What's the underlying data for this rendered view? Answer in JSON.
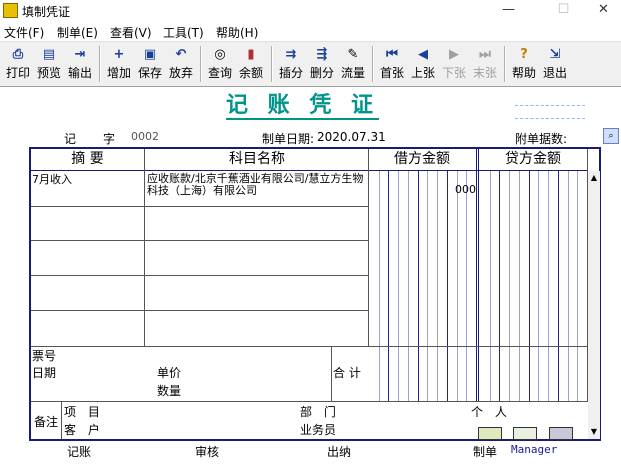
{
  "window": {
    "title": "填制凭证",
    "minimize": "—",
    "maximize": "☐",
    "close": "✕"
  },
  "menu": [
    "文件(F)",
    "制单(E)",
    "查看(V)",
    "工具(T)",
    "帮助(H)"
  ],
  "toolbar": {
    "print": "打印",
    "preview": "预览",
    "export": "输出",
    "add": "增加",
    "save": "保存",
    "discard": "放弃",
    "query": "查询",
    "balance": "余额",
    "insert": "插分",
    "delete": "删分",
    "flow": "流量",
    "first": "首张",
    "prev": "上张",
    "next": "下张",
    "last": "末张",
    "help": "帮助",
    "exit": "退出"
  },
  "voucher": {
    "title": "记 账 凭 证",
    "word_label": "记",
    "word_suffix": "字",
    "number": "0002",
    "date_label": "制单日期:",
    "date": "2020.07.31",
    "attachments_label": "附单据数:"
  },
  "table": {
    "headers": {
      "summary": "摘 要",
      "account": "科目名称",
      "debit": "借方金额",
      "credit": "贷方金额"
    },
    "rows": [
      {
        "summary": "7月收入",
        "account": "应收账款/北京千蕉酒业有限公司/慧立方生物科技（上海）有限公司",
        "debit": "000",
        "credit": ""
      }
    ]
  },
  "detail": {
    "ticket_no": "票号",
    "date": "日期",
    "unit_price": "单价",
    "quantity": "数量",
    "total": "合 计"
  },
  "remarks": {
    "label": "备注",
    "project": "项 目",
    "customer": "客 户",
    "department": "部 门",
    "salesperson": "业务员",
    "individual": "个 人"
  },
  "footer": {
    "bookkeeping": "记账",
    "review": "审核",
    "cashier": "出纳",
    "maker_label": "制单",
    "maker": "Manager"
  }
}
